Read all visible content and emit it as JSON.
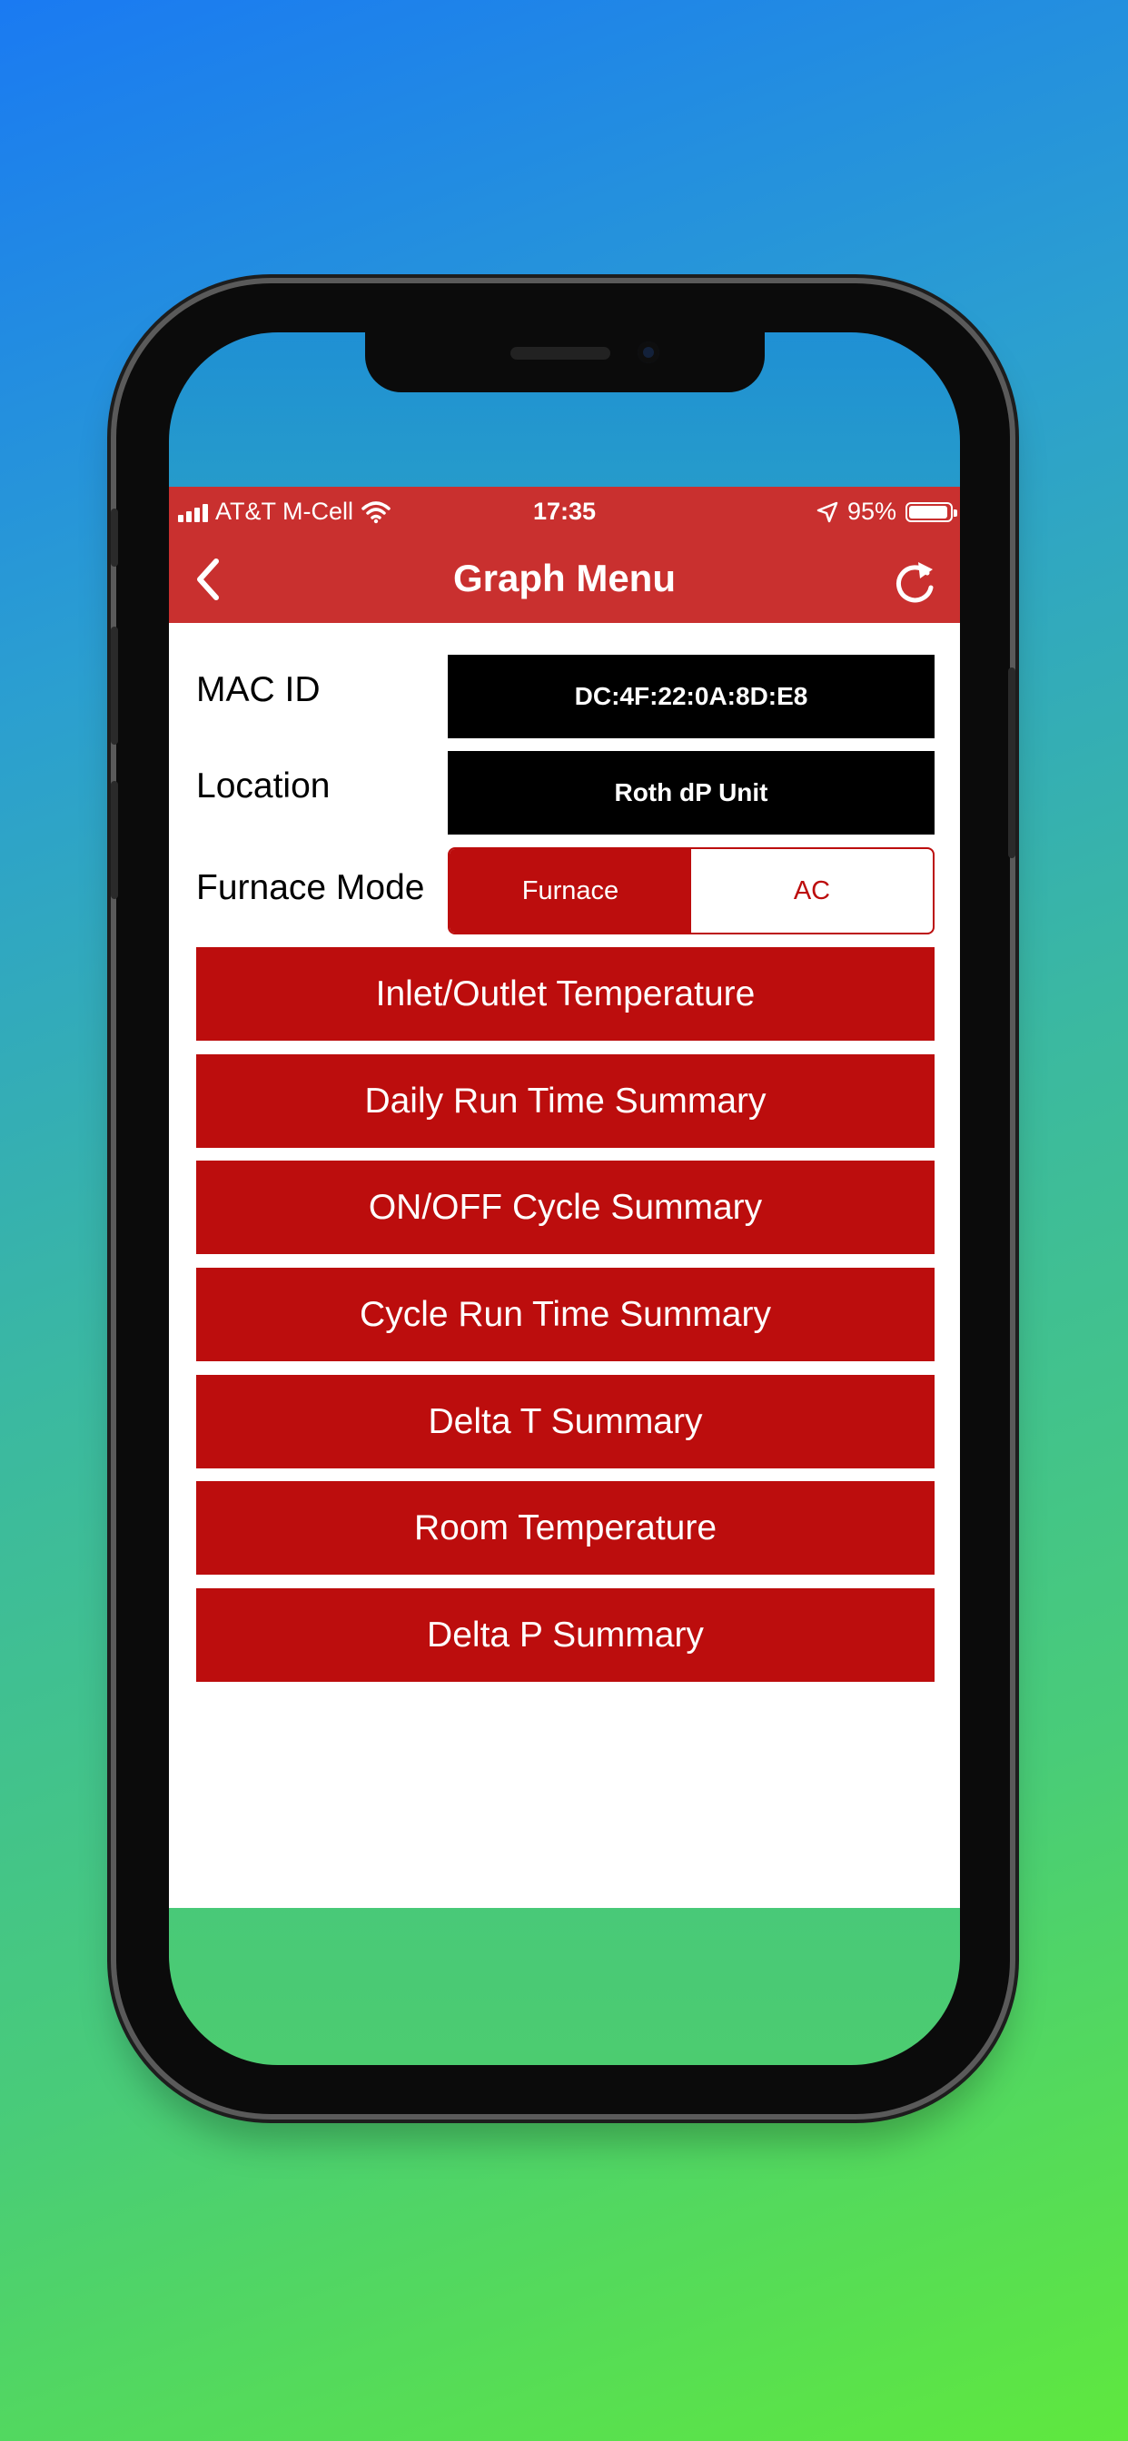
{
  "status_bar": {
    "carrier": "AT&T M-Cell",
    "time": "17:35",
    "battery": "95%",
    "icons": [
      "signal-icon",
      "wifi-icon",
      "location-arrow-icon",
      "battery-icon"
    ]
  },
  "nav": {
    "title": "Graph Menu",
    "back_icon": "chevron-left-icon",
    "refresh_icon": "refresh-icon"
  },
  "device": {
    "mac_label": "MAC ID",
    "mac_value": "DC:4F:22:0A:8D:E8",
    "location_label": "Location",
    "location_value": "Roth dP Unit",
    "mode_label": "Furnace Mode",
    "mode_options": [
      "Furnace",
      "AC"
    ],
    "mode_selected": "Furnace"
  },
  "menu": [
    "Inlet/Outlet Temperature",
    "Daily Run Time Summary",
    "ON/OFF Cycle Summary",
    "Cycle Run Time Summary",
    "Delta T Summary",
    "Room Temperature",
    "Delta P Summary"
  ],
  "colors": {
    "nav_red": "#c9302f",
    "button_red": "#bc0d0d",
    "field_black": "#000000"
  }
}
